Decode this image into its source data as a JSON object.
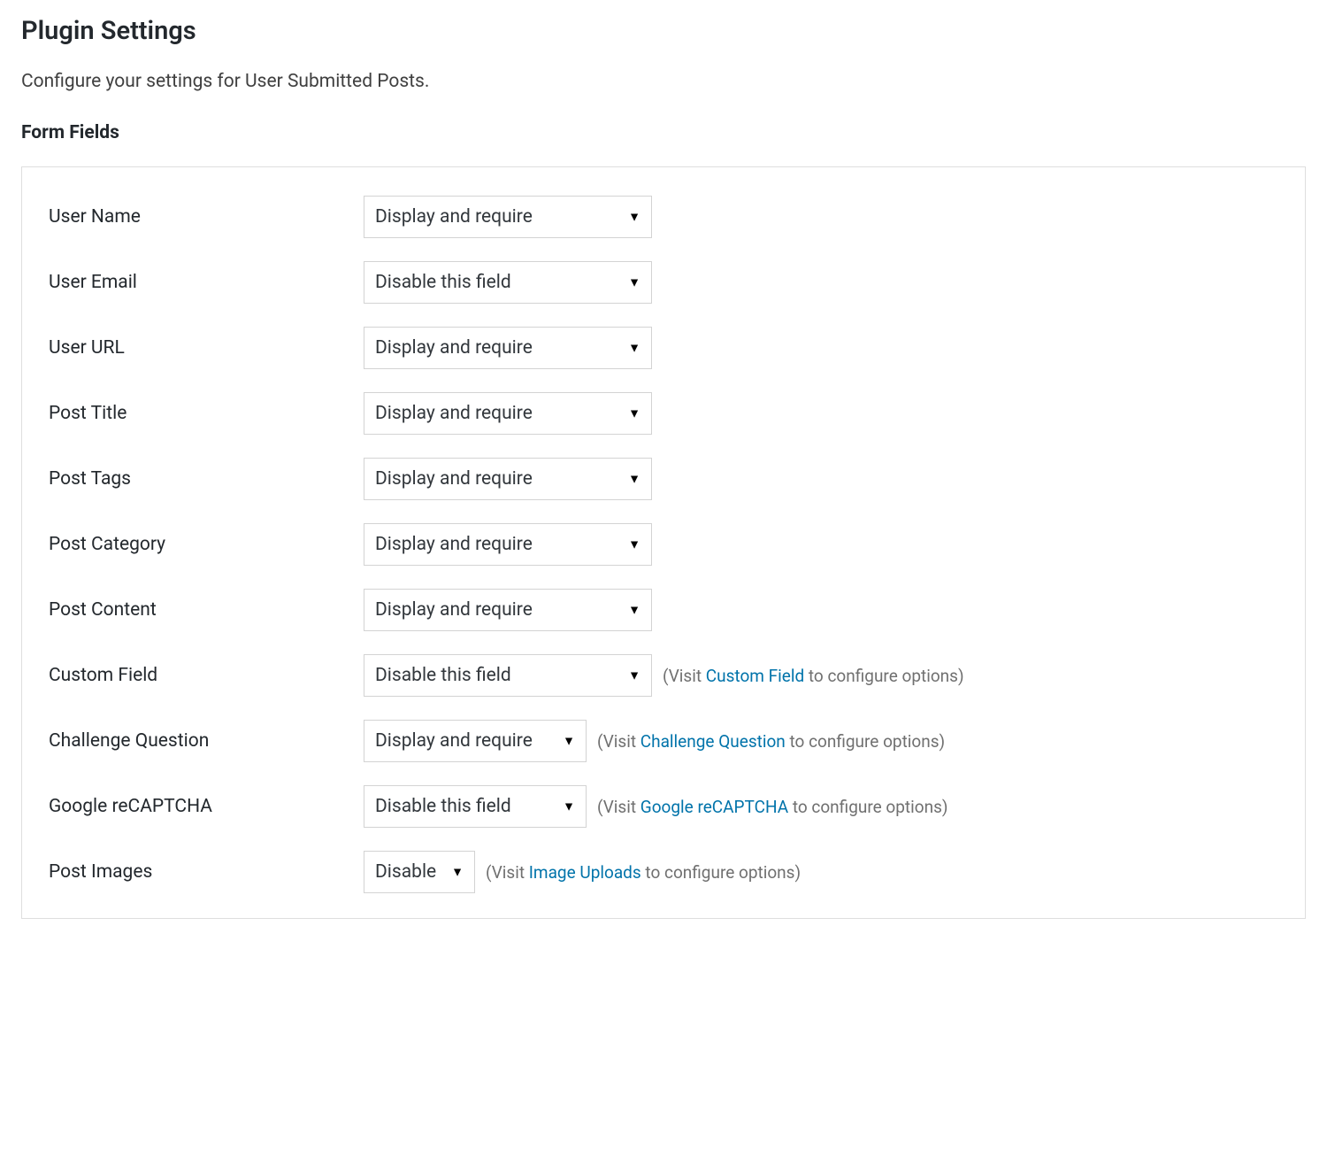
{
  "header": {
    "title": "Plugin Settings",
    "description": "Configure your settings for User Submitted Posts.",
    "section_title": "Form Fields"
  },
  "fields": [
    {
      "label": "User Name",
      "value": "Display and require",
      "size": "wide",
      "note_pre": "",
      "note_link": "",
      "note_post": ""
    },
    {
      "label": "User Email",
      "value": "Disable this field",
      "size": "wide",
      "note_pre": "",
      "note_link": "",
      "note_post": ""
    },
    {
      "label": "User URL",
      "value": "Display and require",
      "size": "wide",
      "note_pre": "",
      "note_link": "",
      "note_post": ""
    },
    {
      "label": "Post Title",
      "value": "Display and require",
      "size": "wide",
      "note_pre": "",
      "note_link": "",
      "note_post": ""
    },
    {
      "label": "Post Tags",
      "value": "Display and require",
      "size": "wide",
      "note_pre": "",
      "note_link": "",
      "note_post": ""
    },
    {
      "label": "Post Category",
      "value": "Display and require",
      "size": "wide",
      "note_pre": "",
      "note_link": "",
      "note_post": ""
    },
    {
      "label": "Post Content",
      "value": "Display and require",
      "size": "wide",
      "note_pre": "",
      "note_link": "",
      "note_post": ""
    },
    {
      "label": "Custom Field",
      "value": "Disable this field",
      "size": "wide",
      "note_pre": "(Visit ",
      "note_link": "Custom Field",
      "note_post": " to configure options)"
    },
    {
      "label": "Challenge Question",
      "value": "Display and require",
      "size": "medium",
      "note_pre": "(Visit ",
      "note_link": "Challenge Question",
      "note_post": " to configure options)"
    },
    {
      "label": "Google reCAPTCHA",
      "value": "Disable this field",
      "size": "medium",
      "note_pre": "(Visit ",
      "note_link": "Google reCAPTCHA",
      "note_post": " to configure options)"
    },
    {
      "label": "Post Images",
      "value": "Disable",
      "size": "small",
      "note_pre": "(Visit ",
      "note_link": "Image Uploads",
      "note_post": " to configure options)"
    }
  ]
}
